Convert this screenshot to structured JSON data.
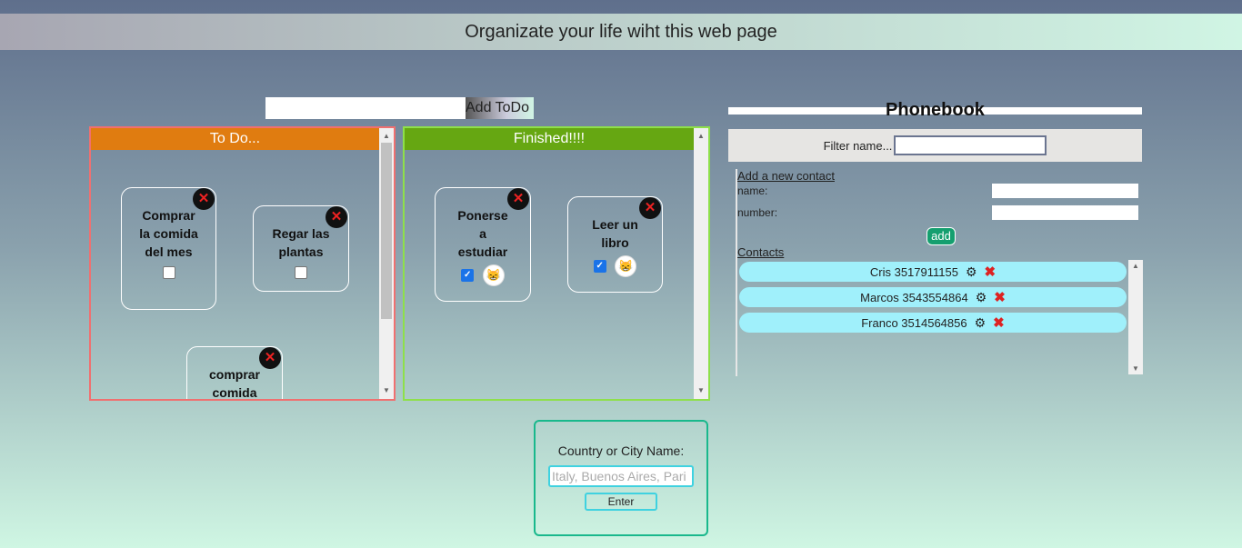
{
  "header": {
    "title": "Organizate your life wiht this web page"
  },
  "todo_form": {
    "input_value": "",
    "add_label": "Add ToDo"
  },
  "todo_panel": {
    "title": "To Do...",
    "items": [
      {
        "text": "Comprar la comida del mes",
        "checked": false
      },
      {
        "text": "Regar las plantas",
        "checked": false
      },
      {
        "text": "comprar comida",
        "checked": false
      }
    ]
  },
  "finished_panel": {
    "title": "Finished!!!!",
    "items": [
      {
        "text": "Ponerse a estudiar",
        "checked": true
      },
      {
        "text": "Leer un libro",
        "checked": true
      }
    ]
  },
  "phonebook": {
    "title": "Phonebook",
    "filter_label": "Filter name...",
    "filter_value": "",
    "add_contact_label": "Add a new contact",
    "name_label": "name:",
    "number_label": "number:",
    "add_label": "add",
    "contacts_label": "Contacts",
    "contacts": [
      {
        "entry": "Cris 3517911155"
      },
      {
        "entry": "Marcos 3543554864"
      },
      {
        "entry": "Franco 3514564856"
      }
    ]
  },
  "weather": {
    "label": "Country or City Name:",
    "placeholder": "Italy, Buenos Aires, Pari",
    "enter_label": "Enter"
  },
  "icons": {
    "delete": "close-icon",
    "edit": "gear-icon",
    "done_badge": "emoji-icon"
  },
  "colors": {
    "todo_header": "#e07c10",
    "finished_header": "#66a712",
    "contact_pill": "#a0f0fb",
    "add_button": "#159f6f"
  }
}
